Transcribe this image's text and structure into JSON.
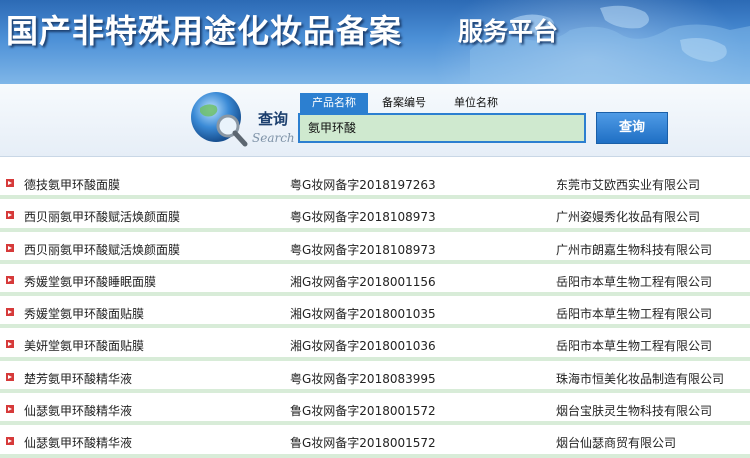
{
  "banner": {
    "title": "国产非特殊用途化妆品备案",
    "subtitle": "服务平台"
  },
  "logo": {
    "cn": "查询",
    "en": "Search"
  },
  "search": {
    "tabs": [
      "产品名称",
      "备案编号",
      "单位名称"
    ],
    "active_tab": "产品名称",
    "value": "氨甲环酸",
    "button_label": "查询"
  },
  "results": [
    {
      "name": "德技氨甲环酸面膜",
      "code": "粤G妆网备字2018197263",
      "company": "东莞市艾欧西实业有限公司"
    },
    {
      "name": "西贝丽氨甲环酸赋活焕颜面膜",
      "code": "粤G妆网备字2018108973",
      "company": "广州姿嫚秀化妆品有限公司"
    },
    {
      "name": "西贝丽氨甲环酸赋活焕颜面膜",
      "code": "粤G妆网备字2018108973",
      "company": "广州市朗嘉生物科技有限公司"
    },
    {
      "name": "秀媛堂氨甲环酸睡眠面膜",
      "code": "湘G妆网备字2018001156",
      "company": "岳阳市本草生物工程有限公司"
    },
    {
      "name": "秀媛堂氨甲环酸面贴膜",
      "code": "湘G妆网备字2018001035",
      "company": "岳阳市本草生物工程有限公司"
    },
    {
      "name": "美妍堂氨甲环酸面贴膜",
      "code": "湘G妆网备字2018001036",
      "company": "岳阳市本草生物工程有限公司"
    },
    {
      "name": "楚芳氨甲环酸精华液",
      "code": "粤G妆网备字2018083995",
      "company": "珠海市恒美化妆品制造有限公司"
    },
    {
      "name": "仙瑟氨甲环酸精华液",
      "code": "鲁G妆网备字2018001572",
      "company": "烟台宝肤灵生物科技有限公司"
    },
    {
      "name": "仙瑟氨甲环酸精华液",
      "code": "鲁G妆网备字2018001572",
      "company": "烟台仙瑟商贸有限公司"
    }
  ],
  "colors": {
    "accent": "#2c7fd0",
    "row_separator": "#d8ecd8",
    "input_bg": "#cfe9cf",
    "bullet": "#d63a3a"
  }
}
